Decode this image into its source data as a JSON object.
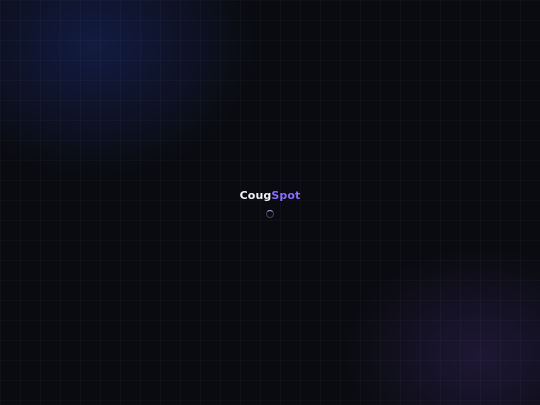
{
  "app": {
    "brand_part_1": "Coug",
    "brand_part_2": "Spot"
  },
  "colors": {
    "background": "#0a0b10",
    "brand_primary_text": "#f2f2f5",
    "brand_accent": "#8b6cf5",
    "glow_top_left": "#1e348c",
    "glow_bottom_right": "#4c348c"
  },
  "loading": {
    "indicator": "spinner-icon"
  }
}
